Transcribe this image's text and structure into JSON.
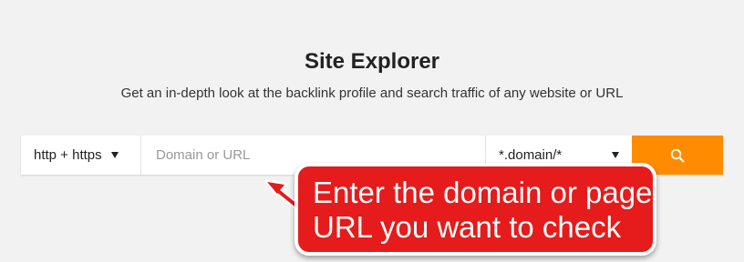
{
  "header": {
    "title": "Site Explorer",
    "subtitle": "Get an in-depth look at the backlink profile and search traffic of any website or URL"
  },
  "search": {
    "protocol_label": "http + https",
    "placeholder": "Domain or URL",
    "value": "",
    "mode_label": "*.domain/*",
    "button_icon": "magnifier-icon"
  },
  "annotation": {
    "line1": "Enter the domain or page",
    "line2": "URL you want to check"
  },
  "colors": {
    "accent": "#ff8c00",
    "callout": "#e61b1b",
    "background": "#f2f2f2"
  }
}
